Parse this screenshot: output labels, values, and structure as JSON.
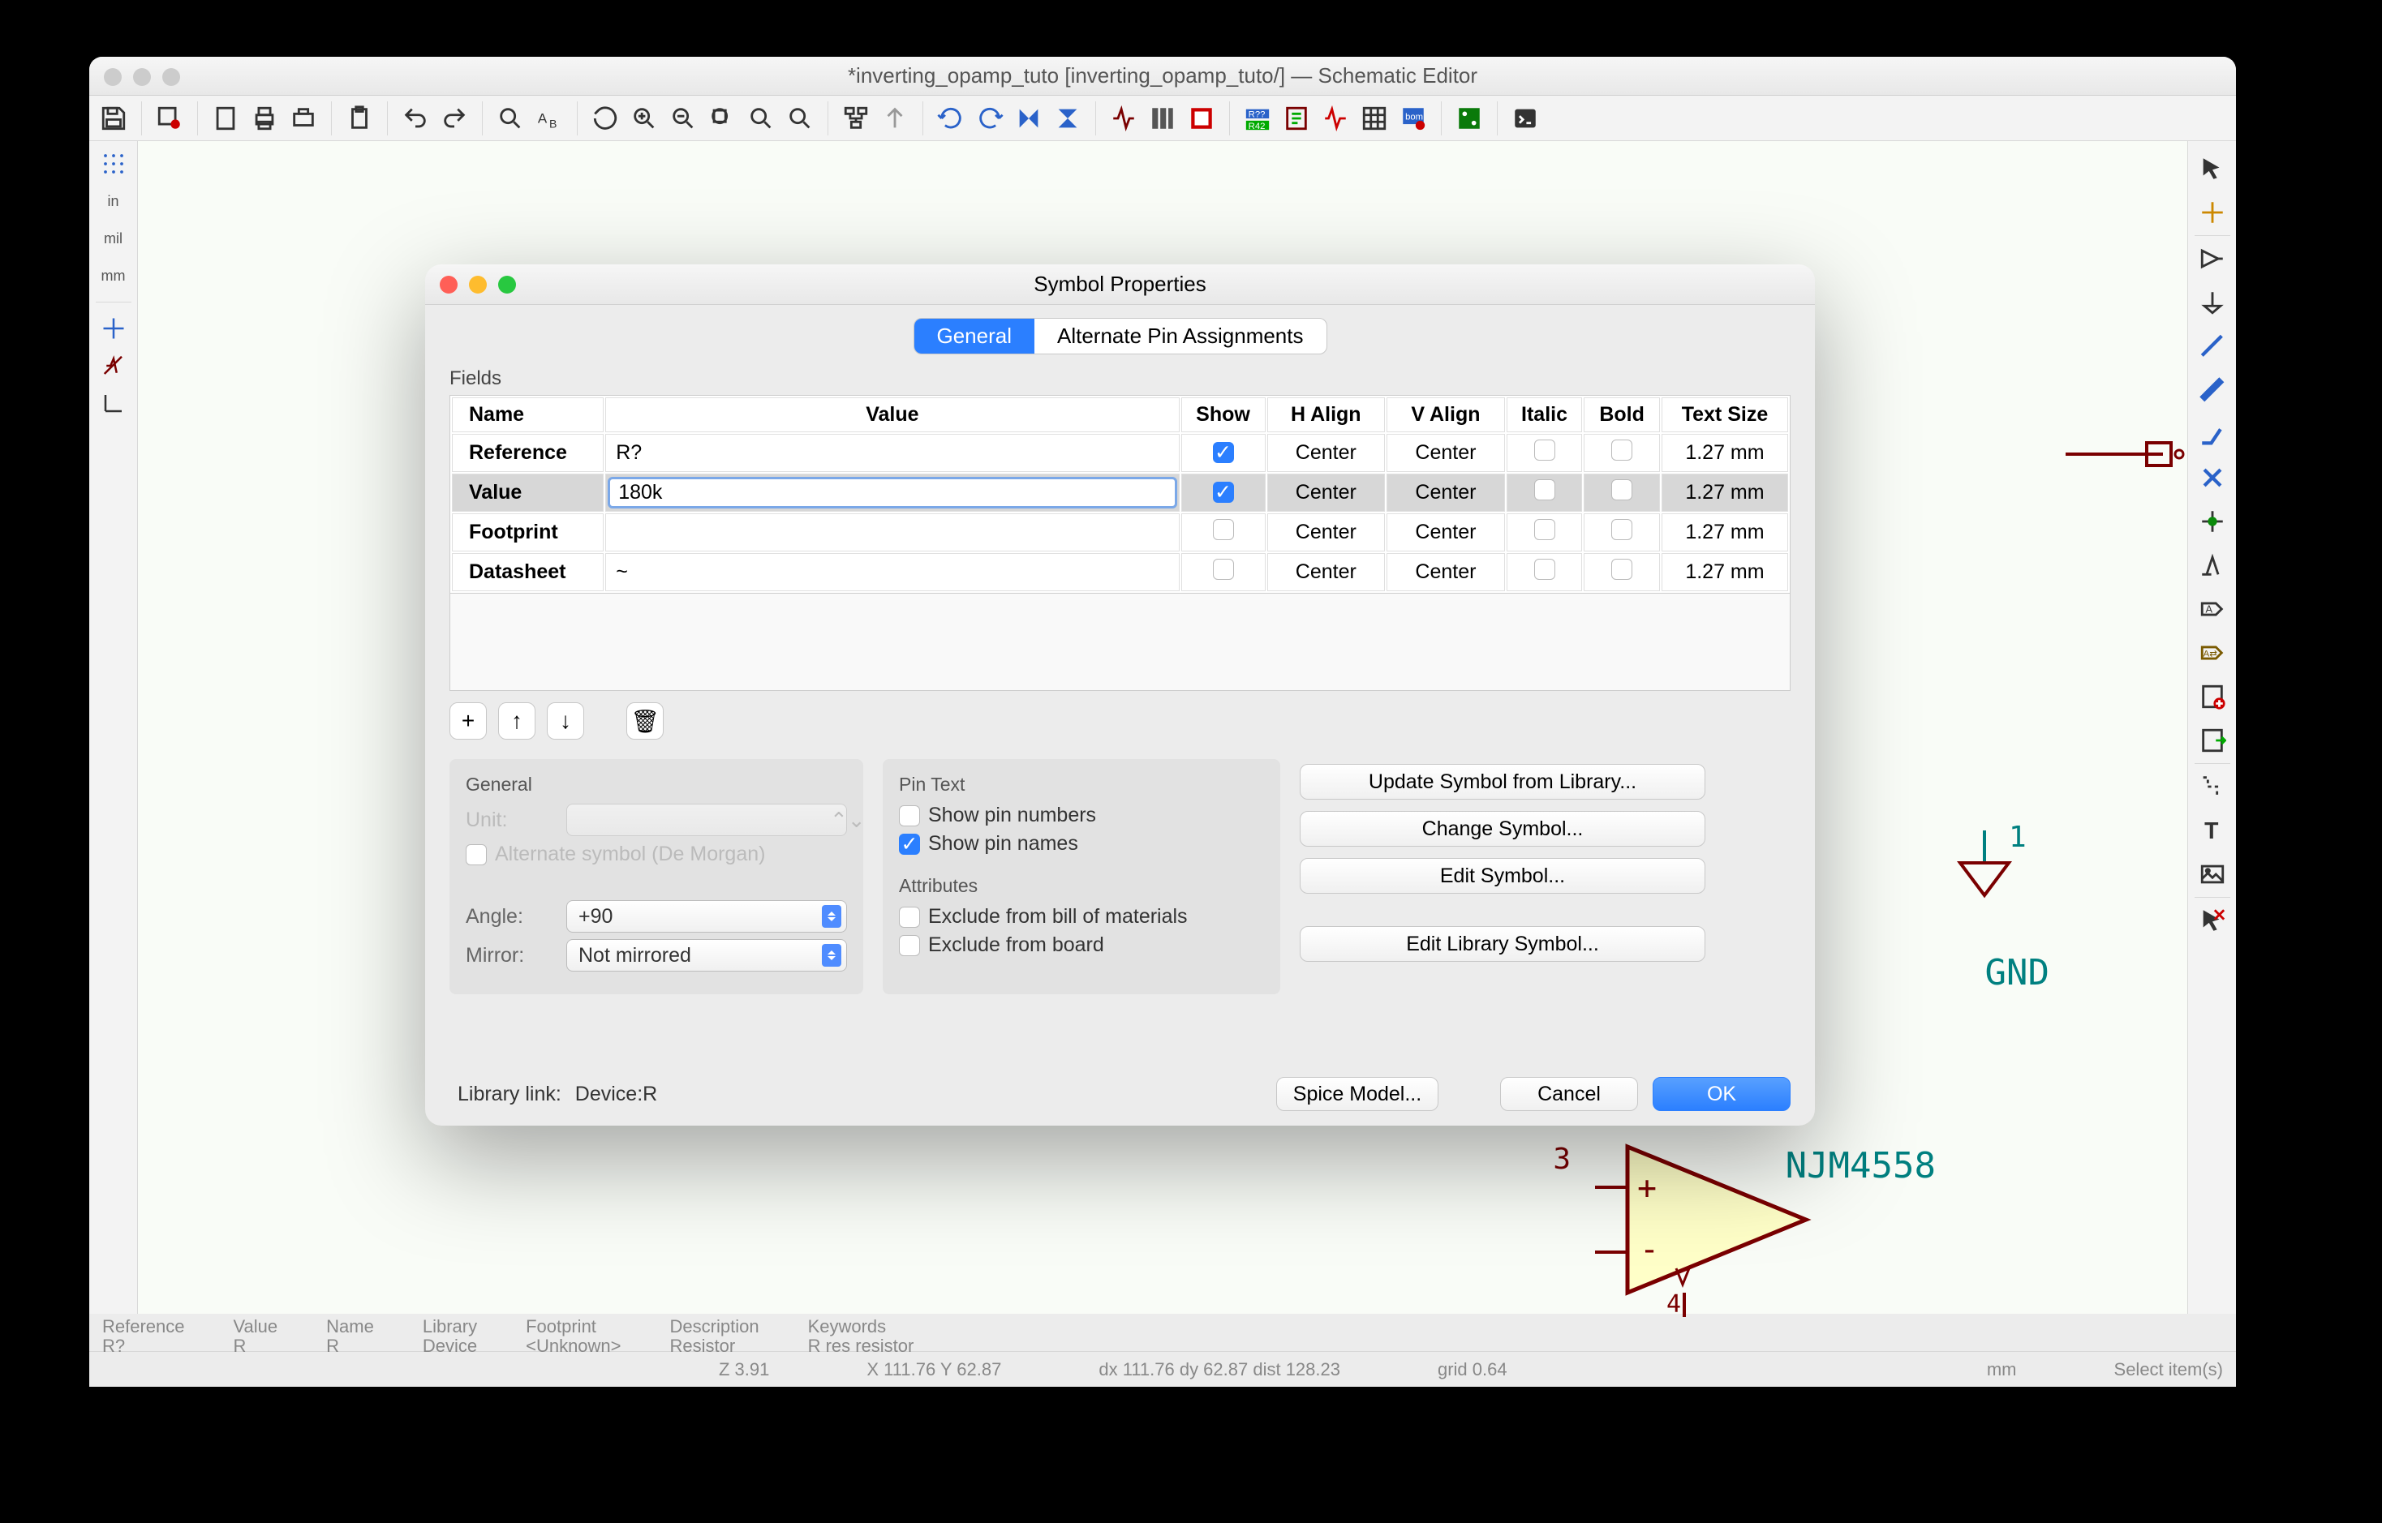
{
  "app": {
    "title": "*inverting_opamp_tuto [inverting_opamp_tuto/] — Schematic Editor"
  },
  "left_rail": {
    "grid": "⊞",
    "in": "in",
    "mil": "mil",
    "mm": "mm"
  },
  "info": {
    "reference_label": "Reference",
    "reference_value": "R?",
    "value_label": "Value",
    "value_value": "R",
    "name_label": "Name",
    "name_value": "R",
    "library_label": "Library",
    "library_value": "Device",
    "footprint_label": "Footprint",
    "footprint_value": "<Unknown>",
    "desc_label": "Description",
    "desc_value": "Resistor",
    "keywords_label": "Keywords",
    "keywords_value": "R res resistor"
  },
  "status": {
    "z": "Z 3.91",
    "xy": "X 111.76  Y 62.87",
    "dxy": "dx 111.76  dy 62.87  dist 128.23",
    "grid": "grid 0.64",
    "unit": "mm",
    "mode": "Select item(s)"
  },
  "dialog": {
    "title": "Symbol Properties",
    "tabs": {
      "general": "General",
      "alt": "Alternate Pin Assignments"
    },
    "fields_label": "Fields",
    "headers": {
      "name": "Name",
      "value": "Value",
      "show": "Show",
      "halign": "H Align",
      "valign": "V Align",
      "italic": "Italic",
      "bold": "Bold",
      "size": "Text Size"
    },
    "rows": [
      {
        "name": "Reference",
        "value": "R?",
        "show": true,
        "halign": "Center",
        "valign": "Center",
        "italic": false,
        "bold": false,
        "size": "1.27 mm",
        "selected": false,
        "editing": false
      },
      {
        "name": "Value",
        "value": "180k",
        "show": true,
        "halign": "Center",
        "valign": "Center",
        "italic": false,
        "bold": false,
        "size": "1.27 mm",
        "selected": true,
        "editing": true
      },
      {
        "name": "Footprint",
        "value": "",
        "show": false,
        "halign": "Center",
        "valign": "Center",
        "italic": false,
        "bold": false,
        "size": "1.27 mm",
        "selected": false,
        "editing": false
      },
      {
        "name": "Datasheet",
        "value": "~",
        "show": false,
        "halign": "Center",
        "valign": "Center",
        "italic": false,
        "bold": false,
        "size": "1.27 mm",
        "selected": false,
        "editing": false
      }
    ],
    "tools": {
      "add": "+",
      "up": "↑",
      "down": "↓",
      "delete": "🗑"
    },
    "general": {
      "label": "General",
      "unit_label": "Unit:",
      "unit_value": "",
      "altsym_label": "Alternate symbol (De Morgan)",
      "angle_label": "Angle:",
      "angle_value": "+90",
      "mirror_label": "Mirror:",
      "mirror_value": "Not mirrored"
    },
    "pintext": {
      "label": "Pin Text",
      "show_numbers": "Show pin numbers",
      "show_names": "Show pin names"
    },
    "attributes": {
      "label": "Attributes",
      "excl_bom": "Exclude from bill of materials",
      "excl_board": "Exclude from board"
    },
    "side_buttons": {
      "update": "Update Symbol from Library...",
      "change": "Change Symbol...",
      "edit": "Edit Symbol...",
      "edit_lib": "Edit Library Symbol..."
    },
    "footer": {
      "lib_label": "Library link:",
      "lib_value": "Device:R",
      "spice": "Spice Model...",
      "cancel": "Cancel",
      "ok": "OK"
    }
  },
  "canvas": {
    "gnd": "GND",
    "njm": "NJM4558",
    "pin3": "3"
  }
}
